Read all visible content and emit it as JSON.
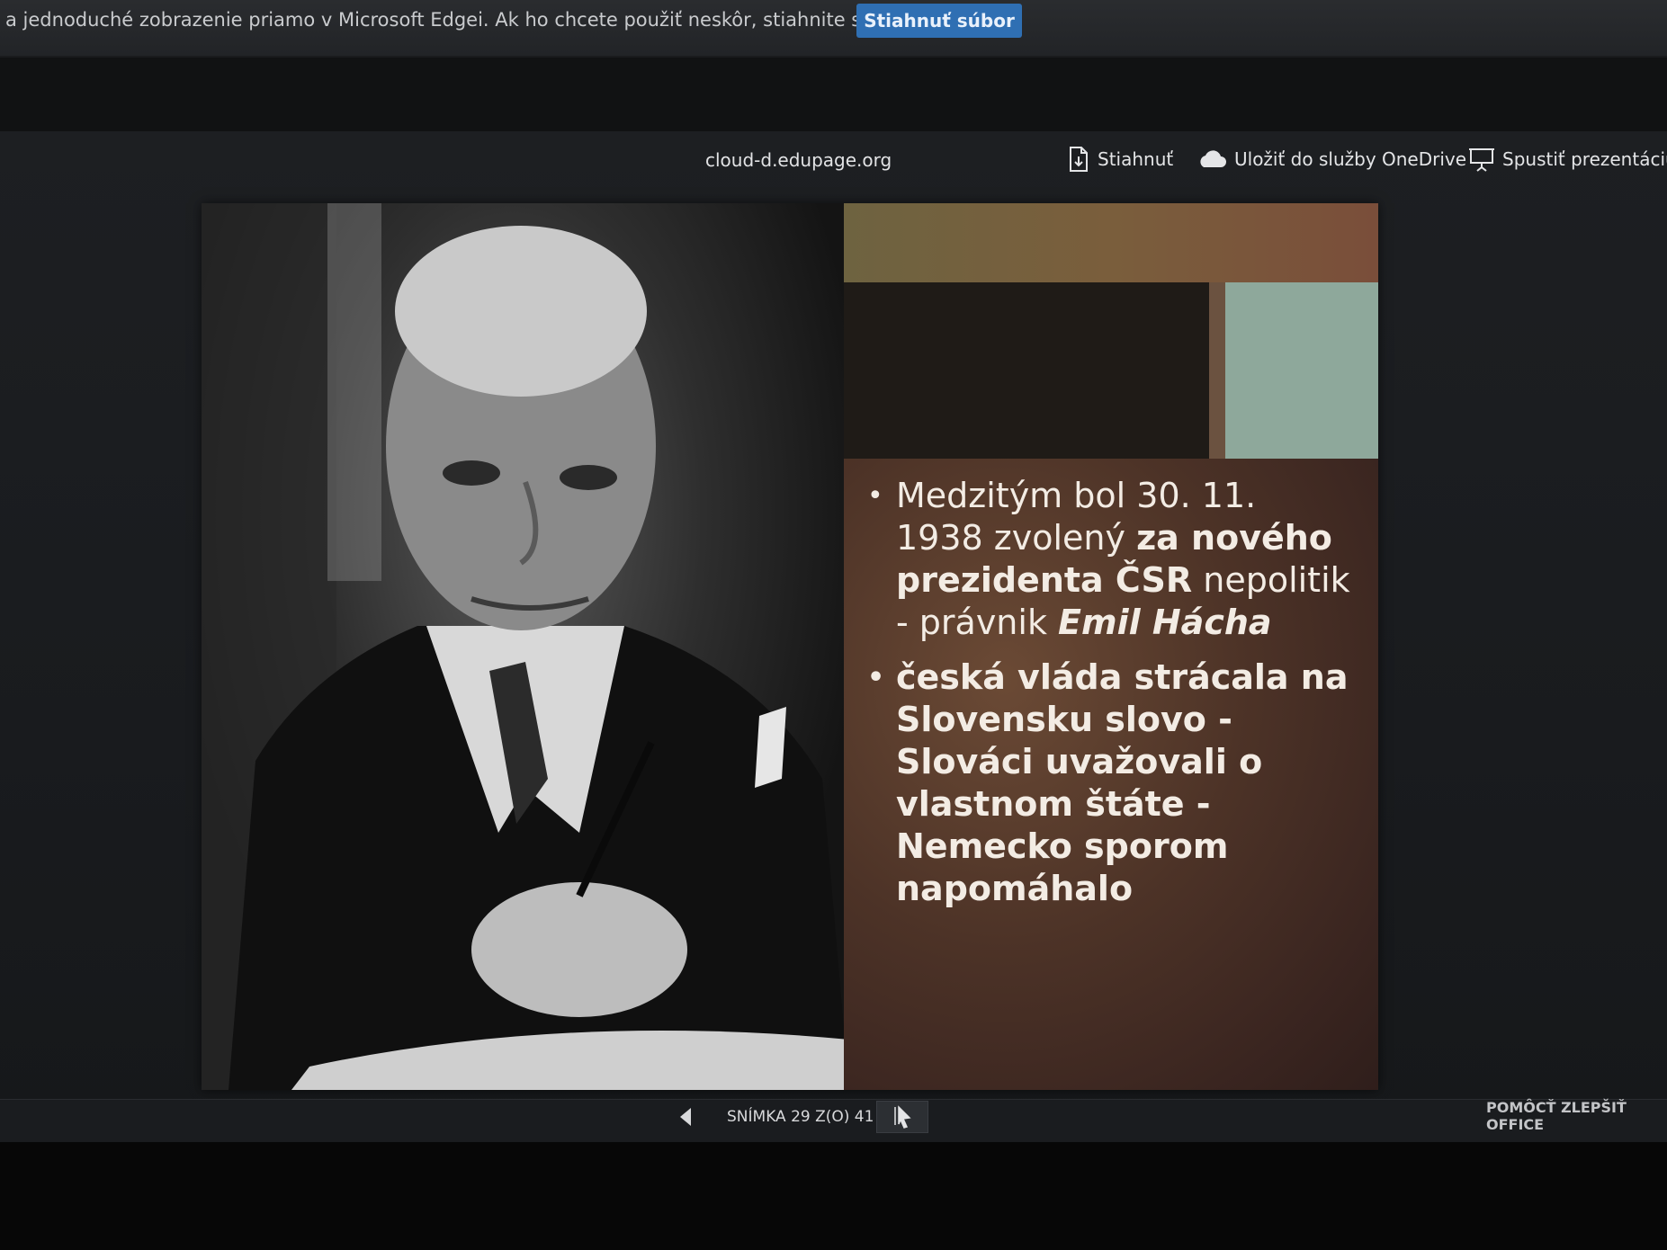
{
  "infobar": {
    "message": "a jednoduché zobrazenie priamo v Microsoft Edgei. Ak ho chcete použiť neskôr, stiahnite si ho.",
    "download_file_label": "Stiahnuť súbor"
  },
  "toolbar": {
    "title": "cloud-d.edupage.org",
    "download_label": "Stiahnuť",
    "save_onedrive_label": "Uložiť do služby OneDrive",
    "start_presentation_label": "Spustiť prezentáciu"
  },
  "slide": {
    "bullet1": {
      "part1": "Medzitým bol 30. 11. 1938 zvolený ",
      "part2": "za nového prezidenta ČSR",
      "part3": " nepolitik - právnik ",
      "part4": "Emil Hácha"
    },
    "bullet2": "česká vláda strácala na Slovensku slovo - Slováci uvažovali o vlastnom štáte - Nemecko sporom napomáhalo"
  },
  "statusbar": {
    "slide_counter": "SNÍMKA 29 Z(O) 41",
    "help_improve_label": "POMÔCŤ ZLEPŠIŤ OFFICE"
  },
  "colors": {
    "accent_blue": "#2f6fb3",
    "panel_brown": "#4d3327",
    "panel_mint": "#8ea89b",
    "panel_top": "#7a5e3c"
  },
  "icons": {
    "download": "download-icon",
    "onedrive": "cloud-icon",
    "presentation": "presentation-icon",
    "prev": "chevron-left-icon",
    "next": "cursor-icon"
  }
}
